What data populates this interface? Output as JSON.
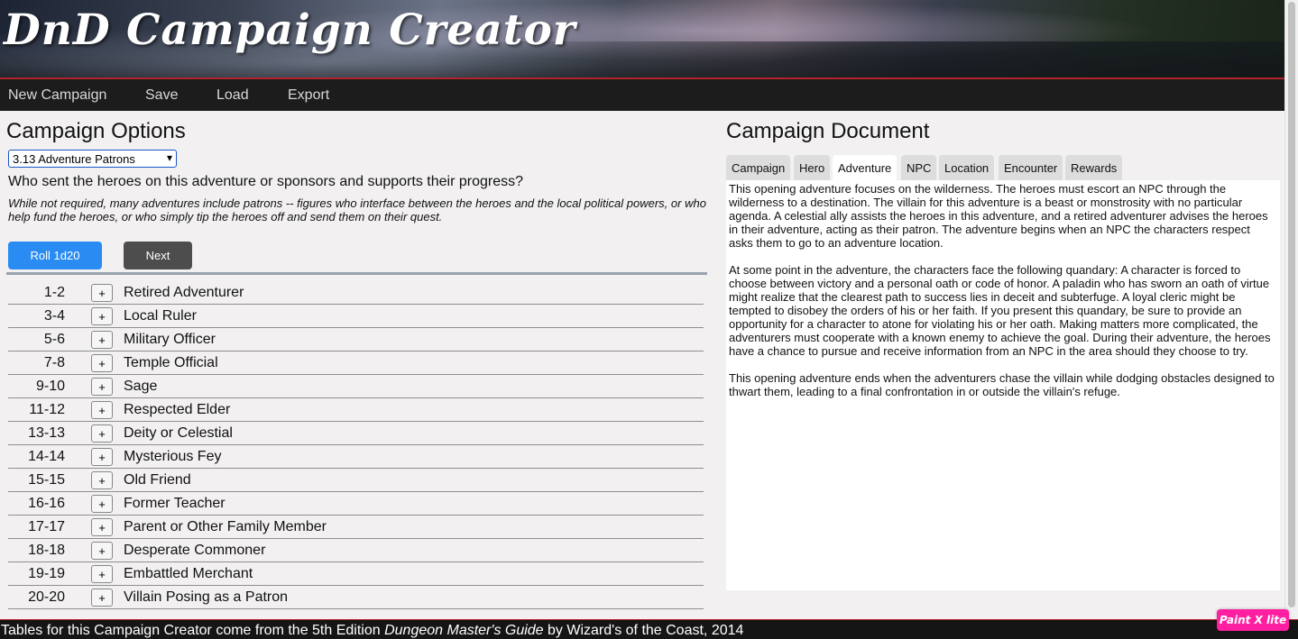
{
  "header": {
    "title": "DnD Campaign Creator"
  },
  "nav": {
    "items": [
      {
        "label": "New Campaign"
      },
      {
        "label": "Save"
      },
      {
        "label": "Load"
      },
      {
        "label": "Export"
      }
    ]
  },
  "options": {
    "title": "Campaign Options",
    "selected_table": "3.13 Adventure Patrons",
    "question": "Who sent the heroes on this adventure or sponsors and supports their progress?",
    "description": "While not required, many adventures include patrons -- figures who interface between the heroes and the local political powers, or who help fund the heroes, or who simply tip the heroes off and send them on their quest.",
    "roll_label": "Roll 1d20",
    "next_label": "Next",
    "add_symbol": "+",
    "rows": [
      {
        "range": "1-2",
        "label": "Retired Adventurer"
      },
      {
        "range": "3-4",
        "label": "Local Ruler"
      },
      {
        "range": "5-6",
        "label": "Military Officer"
      },
      {
        "range": "7-8",
        "label": "Temple Official"
      },
      {
        "range": "9-10",
        "label": "Sage"
      },
      {
        "range": "11-12",
        "label": "Respected Elder"
      },
      {
        "range": "13-13",
        "label": "Deity or Celestial"
      },
      {
        "range": "14-14",
        "label": "Mysterious Fey"
      },
      {
        "range": "15-15",
        "label": "Old Friend"
      },
      {
        "range": "16-16",
        "label": "Former Teacher"
      },
      {
        "range": "17-17",
        "label": "Parent or Other Family Member"
      },
      {
        "range": "18-18",
        "label": "Desperate Commoner"
      },
      {
        "range": "19-19",
        "label": "Embattled Merchant"
      },
      {
        "range": "20-20",
        "label": "Villain Posing as a Patron"
      }
    ]
  },
  "document": {
    "title": "Campaign Document",
    "tabs": [
      {
        "label": "Campaign"
      },
      {
        "label": "Hero"
      },
      {
        "label": "Adventure",
        "active": true
      },
      {
        "label": "NPC"
      },
      {
        "label": "Location"
      },
      {
        "label": "Encounter"
      },
      {
        "label": "Rewards"
      }
    ],
    "paragraphs": [
      "This opening adventure focuses on the wilderness.  The heroes must escort an NPC through the wilderness to a destination.  The villain for this adventure is a beast or monstrosity with no particular agenda.  A celestial ally assists the heroes in this adventure, and a retired adventurer advises the heroes in their adventure, acting as their patron.  The adventure begins when an NPC the characters respect asks them to go to an adventure location.",
      "At some point in the adventure, the characters face the following quandary: A character is forced to choose between victory and a personal oath or code of honor. A paladin who has sworn an oath of virtue might realize that the clearest path to success lies in deceit and subterfuge. A loyal cleric might be tempted to disobey the orders of his or her faith. If you present this quandary, be sure to provide an opportunity for a character to atone for violating his or her oath.  Making matters more complicated, the adventurers must cooperate with a known enemy to achieve the goal.  During their adventure, the heroes have a chance to pursue and receive information from an NPC in the area should they choose to try.",
      "This opening adventure ends when the adventurers chase the villain while dodging obstacles designed to thwart them, leading to a final confrontation in or outside the villain's refuge."
    ]
  },
  "footer": {
    "prefix": "Tables for this Campaign Creator come from the 5th Edition ",
    "book": "Dungeon Master's Guide",
    "suffix": " by Wizard's of the Coast, 2014"
  },
  "badge": {
    "label": "Paint X lite"
  },
  "colors": {
    "accent": "#2a8cf2",
    "banner_rule": "#b3242a",
    "badge": "#ff1fa0"
  }
}
